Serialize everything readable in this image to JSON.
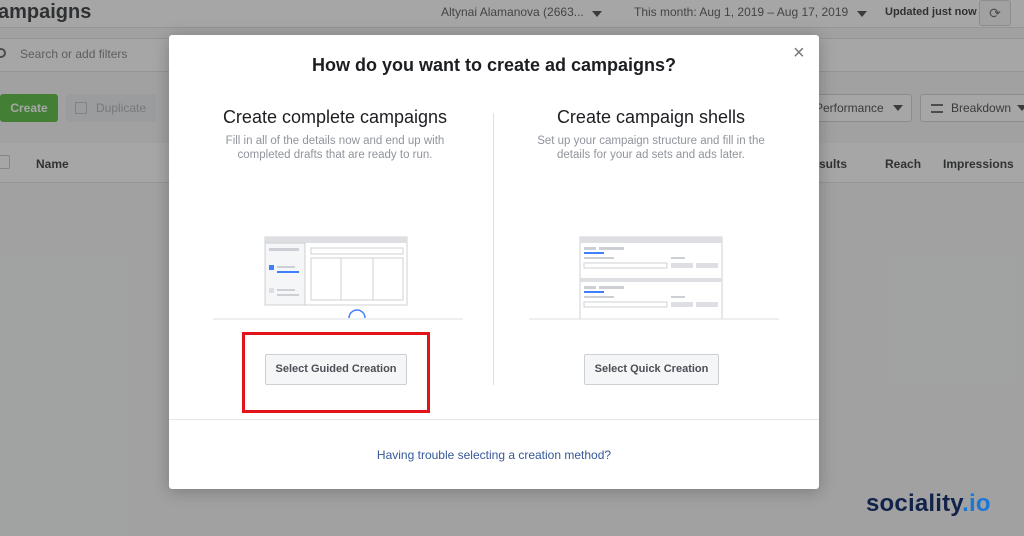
{
  "app": {
    "page_title": "ampaigns",
    "account": "Altynai Alamanova (2663...",
    "date_range": "This month: Aug 1, 2019 – Aug 17, 2019",
    "updated": "Updated just now",
    "search_placeholder": "Search or add filters",
    "create_label": "Create",
    "duplicate_label": "Duplicate",
    "performance_label": "Performance",
    "breakdown_label": "Breakdown",
    "columns": {
      "name": "Name",
      "results": "sults",
      "reach": "Reach",
      "impressions": "Impressions"
    }
  },
  "modal": {
    "title": "How do you want to create ad campaigns?",
    "options": [
      {
        "title": "Create complete campaigns",
        "description": "Fill in all of the details now and end up with completed drafts that are ready to run.",
        "button": "Select Guided Creation"
      },
      {
        "title": "Create campaign shells",
        "description": "Set up your campaign structure and fill in the details for your ad sets and ads later.",
        "button": "Select Quick Creation"
      }
    ],
    "footer_link": "Having trouble selecting a creation method?",
    "close_glyph": "×"
  },
  "brand": {
    "name": "sociality",
    "tld": ".io"
  },
  "colors": {
    "create_green": "#42b72a",
    "highlight_red": "#e3131a",
    "link_blue": "#365899",
    "brand_navy": "#12234a"
  }
}
